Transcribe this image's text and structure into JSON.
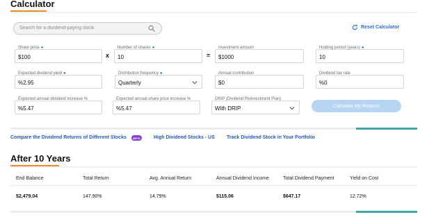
{
  "calculator": {
    "title": "Calculator",
    "search_placeholder": "Search for a dividend-paying stock",
    "reset_label": "Reset Calculator",
    "fields": {
      "share_price": {
        "label": "Share price",
        "value": "$100",
        "required": true
      },
      "number_of_shares": {
        "label": "Number of shares",
        "value": "10",
        "required": true
      },
      "investment_amount": {
        "label": "Investment amount",
        "value": "$1000",
        "required": false
      },
      "holding_period": {
        "label": "Holding period (years)",
        "value": "10",
        "required": true
      },
      "dividend_yield": {
        "label": "Expected dividend yield",
        "value": "%2.95",
        "required": true
      },
      "distribution_frequency": {
        "label": "Distribution frequency",
        "value": "Quarterly",
        "required": true
      },
      "annual_contribution": {
        "label": "Annual contribution",
        "value": "$0",
        "required": false
      },
      "dividend_tax_rate": {
        "label": "Dividend tax rate",
        "value": "%0",
        "required": false
      },
      "annual_dividend_increase": {
        "label": "Expected annual dividend increase %",
        "value": "%5.47",
        "required": false
      },
      "annual_share_price_increase": {
        "label": "Expected annual share price increase %",
        "value": "%5.47",
        "required": false
      },
      "drip": {
        "label": "DRIP (Dividend Reinvestment Plan)",
        "value": "With DRIP",
        "required": false
      }
    },
    "operators": {
      "multiply": "x",
      "equals": "="
    },
    "calculate_label": "Calculate My Returns"
  },
  "links": {
    "compare": "Compare the Dividend Returns of Different Stocks",
    "beta": "BETA",
    "high_dividend": "High Dividend Stocks - US",
    "track": "Track Dividend Stock in Your Portfolio"
  },
  "results": {
    "title": "After 10 Years",
    "columns": [
      "End Balance",
      "Total Return",
      "Avg. Annual Return",
      "Annual Dividend Income",
      "Total Dividend Payment",
      "Yield on Cost"
    ],
    "values": [
      "$2,479.04",
      "147.90%",
      "14.79%",
      "$115.06",
      "$647.17",
      "12.72%"
    ]
  },
  "colors": {
    "accent_orange": "#f08a24",
    "link_blue": "#2559b8",
    "button_disabled": "#b7d4f3",
    "teal_accent": "#3aa7a3",
    "beta_purple": "#8a3fd0"
  },
  "icons": {
    "search": "search-icon",
    "reset": "refresh-icon",
    "dropdown": "chevron-down-icon"
  }
}
